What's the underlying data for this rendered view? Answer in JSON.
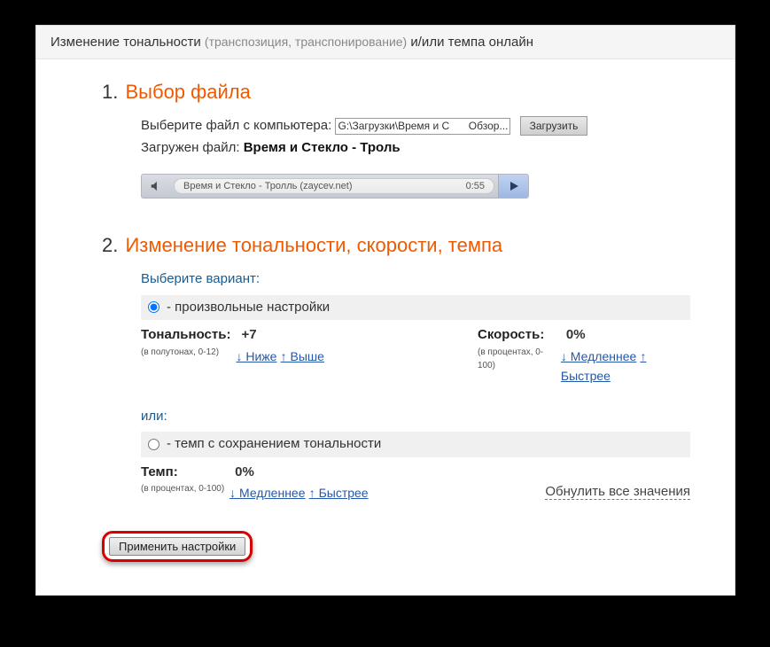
{
  "header": {
    "main": "Изменение тональности",
    "sub": "(транспозиция, транспонирование)",
    "tail": "и/или темпа онлайн"
  },
  "step1": {
    "num": "1.",
    "title": "Выбор файла",
    "choose_label": "Выберите файл с компьютера:",
    "file_path": "G:\\Загрузки\\Время и С",
    "browse": "Обзор...",
    "upload": "Загрузить",
    "loaded_label": "Загружен файл:",
    "loaded_file": "Время и Стекло - Троль",
    "player_title": "Время и Стекло - Тролль (zaycev.net)",
    "player_time": "0:55"
  },
  "step2": {
    "num": "2.",
    "title": "Изменение тональности, скорости, темпа",
    "choose_variant": "Выберите вариант:",
    "option1": "- произвольные настройки",
    "tone_label": "Тональность:",
    "tone_value": "+7",
    "tone_note": "(в полутонах, 0-12)",
    "lower": "↓ Ниже",
    "higher": "↑ Выше",
    "speed_label": "Скорость:",
    "speed_value": "0%",
    "speed_note": "(в процентах, 0-100)",
    "slower": "↓ Медленнее",
    "faster": "↑ Быстрее",
    "or": "или:",
    "option2": "- темп с сохранением тональности",
    "tempo_label": "Темп:",
    "tempo_value": "0%",
    "tempo_note": "(в процентах, 0-100)",
    "reset": "Обнулить все значения"
  },
  "apply": "Применить настройки"
}
